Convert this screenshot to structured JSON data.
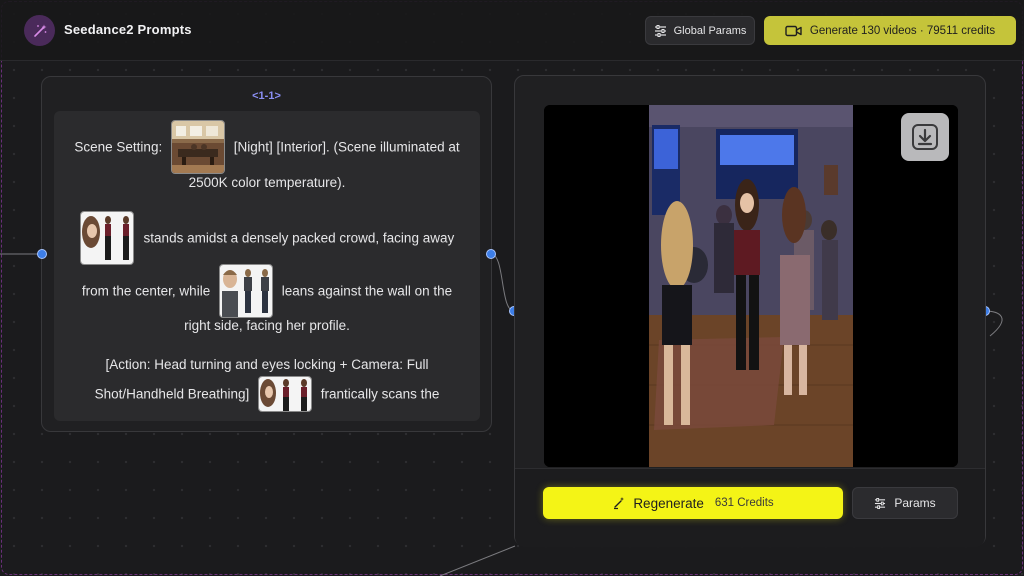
{
  "header": {
    "app_title": "Seedance2 Prompts",
    "global_params_label": "Global Params",
    "generate_label": "Generate 130 videos · 79511 credits",
    "logo_icon": "magic-wand-icon",
    "accent_color": "#c5c43a"
  },
  "prompt_node": {
    "id_label": "<1-1>",
    "lines": {
      "l1a": "Scene Setting:",
      "l1b": "[Night] [Interior]. (Scene illuminated at",
      "l2": "2500K color temperature).",
      "l3": "stands amidst a densely packed crowd, facing away",
      "l4a": "from the center, while",
      "l4b": "leans against the wall on the",
      "l5": "right side, facing her profile.",
      "l6": "[Action: Head turning and eyes locking + Camera: Full",
      "l7a": "Shot/Handheld Breathing]",
      "l7b": "frantically scans the"
    },
    "thumbnails": [
      "room-thumbnail",
      "woman-character-thumbnail",
      "man-character-thumbnail",
      "woman-character-thumbnail"
    ]
  },
  "video_node": {
    "download_icon": "download-icon",
    "regenerate_label": "Regenerate",
    "regenerate_credits": "631 Credits",
    "params_label": "Params",
    "regenerate_color": "#f4f416"
  }
}
